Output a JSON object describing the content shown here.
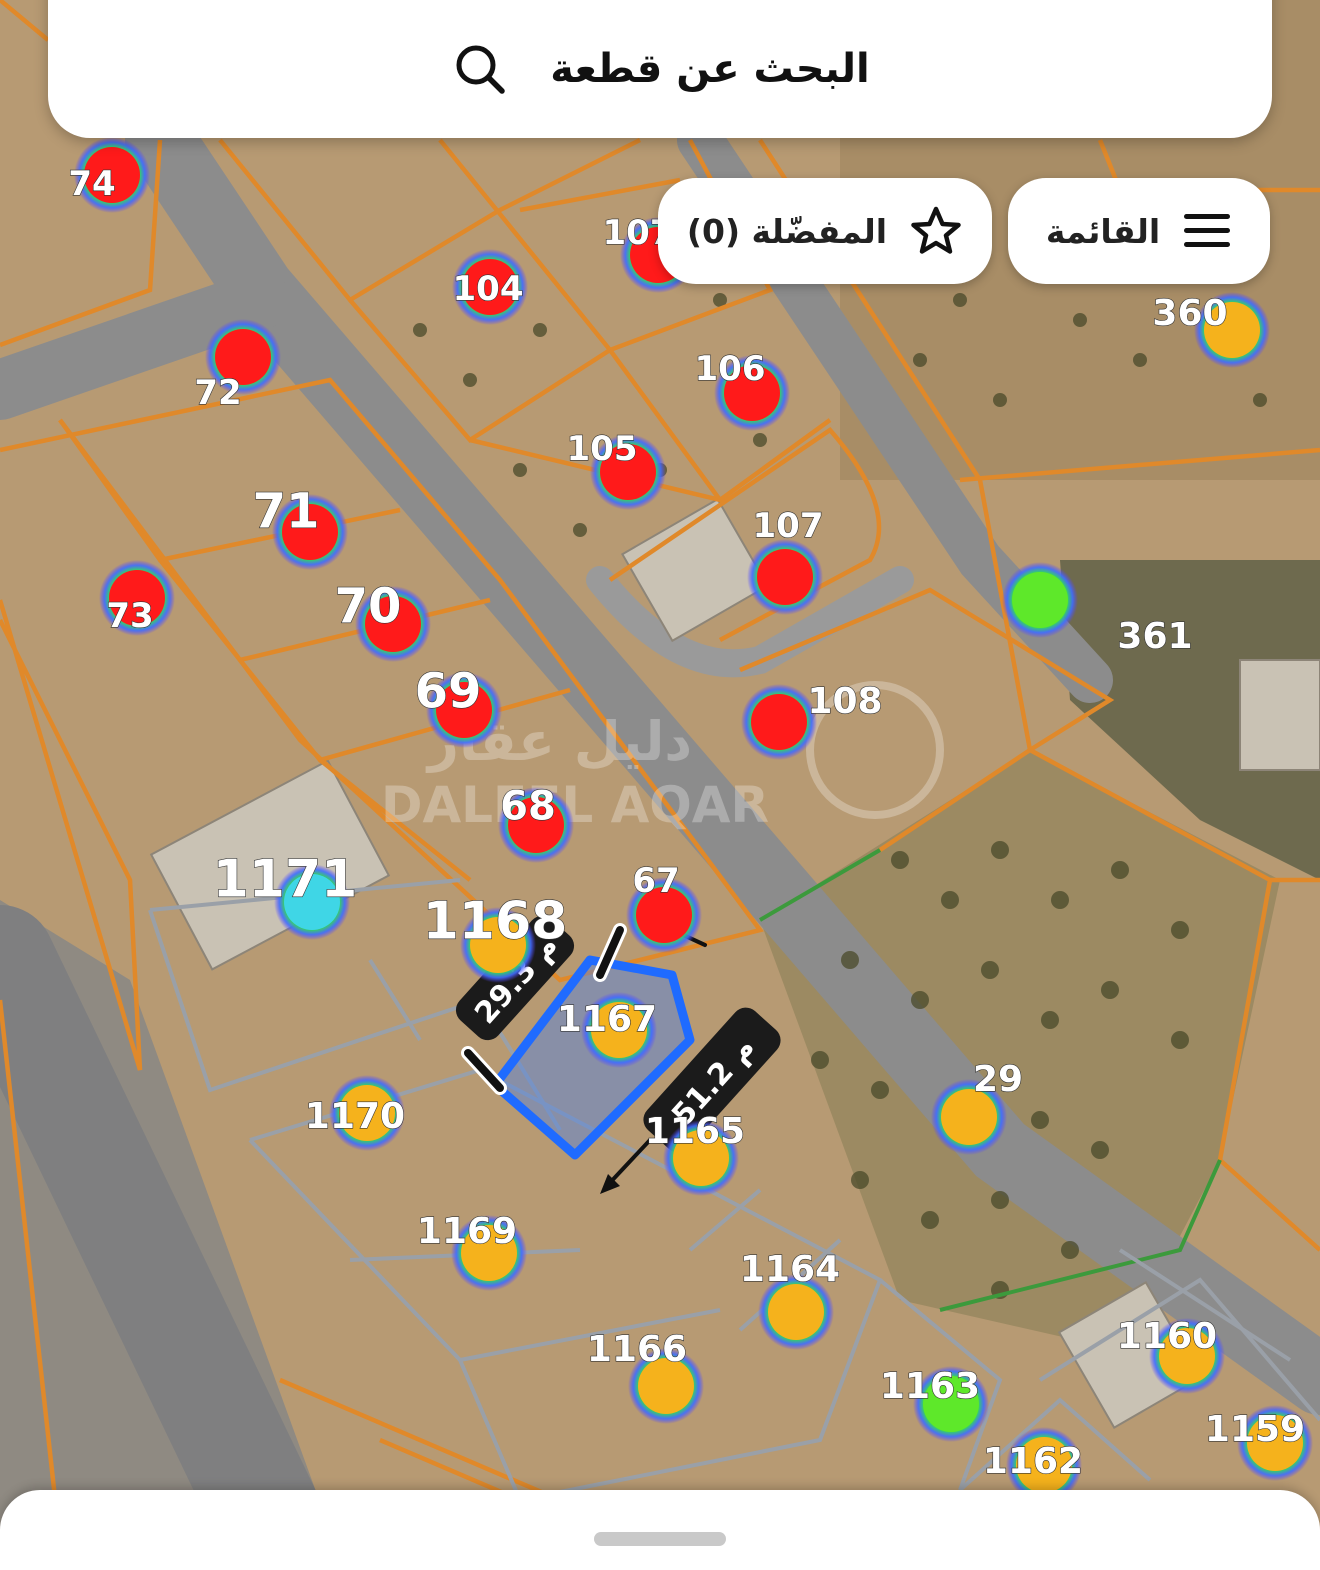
{
  "search": {
    "label": "البحث عن قطعة"
  },
  "menu": {
    "label": "القائمة"
  },
  "favorites": {
    "label": "المفضّلة (0)"
  },
  "watermark": {
    "arabic": "دليل عقار",
    "latin": "DALEEL AQAR"
  },
  "measurements": [
    {
      "id": "m1",
      "label": "29.3 م"
    },
    {
      "id": "m2",
      "label": "51.2 م"
    }
  ],
  "colors": {
    "red": "#ff1a1a",
    "yellow": "#f5b21c",
    "green": "#5ee82a",
    "cyan": "#3fd6e6",
    "boundary": "#dd8a2a",
    "grey_boundary": "#9aa0a8",
    "selected": "#1f6bff"
  },
  "plots": [
    {
      "label": "74",
      "status": "red"
    },
    {
      "label": "104",
      "status": "red"
    },
    {
      "label": "107",
      "status": "red"
    },
    {
      "label": "72",
      "status": "red"
    },
    {
      "label": "106",
      "status": "red"
    },
    {
      "label": "105",
      "status": "red"
    },
    {
      "label": "71",
      "status": "red"
    },
    {
      "label": "107",
      "status": "red"
    },
    {
      "label": "73",
      "status": "red"
    },
    {
      "label": "70",
      "status": "red"
    },
    {
      "label": "69",
      "status": "red"
    },
    {
      "label": "108",
      "status": "red"
    },
    {
      "label": "68",
      "status": "red"
    },
    {
      "label": "67",
      "status": "red"
    },
    {
      "label": "360",
      "status": "yellow"
    },
    {
      "label": "361",
      "status": "green"
    },
    {
      "label": "1171",
      "status": "cyan"
    },
    {
      "label": "1168",
      "status": "yellow"
    },
    {
      "label": "1167",
      "status": "yellow"
    },
    {
      "label": "1170",
      "status": "yellow"
    },
    {
      "label": "1165",
      "status": "yellow"
    },
    {
      "label": "29",
      "status": "yellow"
    },
    {
      "label": "1169",
      "status": "yellow"
    },
    {
      "label": "1164",
      "status": "yellow"
    },
    {
      "label": "1166",
      "status": "yellow"
    },
    {
      "label": "1163",
      "status": "green"
    },
    {
      "label": "1160",
      "status": "yellow"
    },
    {
      "label": "1162",
      "status": "yellow"
    },
    {
      "label": "1159",
      "status": "yellow"
    }
  ]
}
